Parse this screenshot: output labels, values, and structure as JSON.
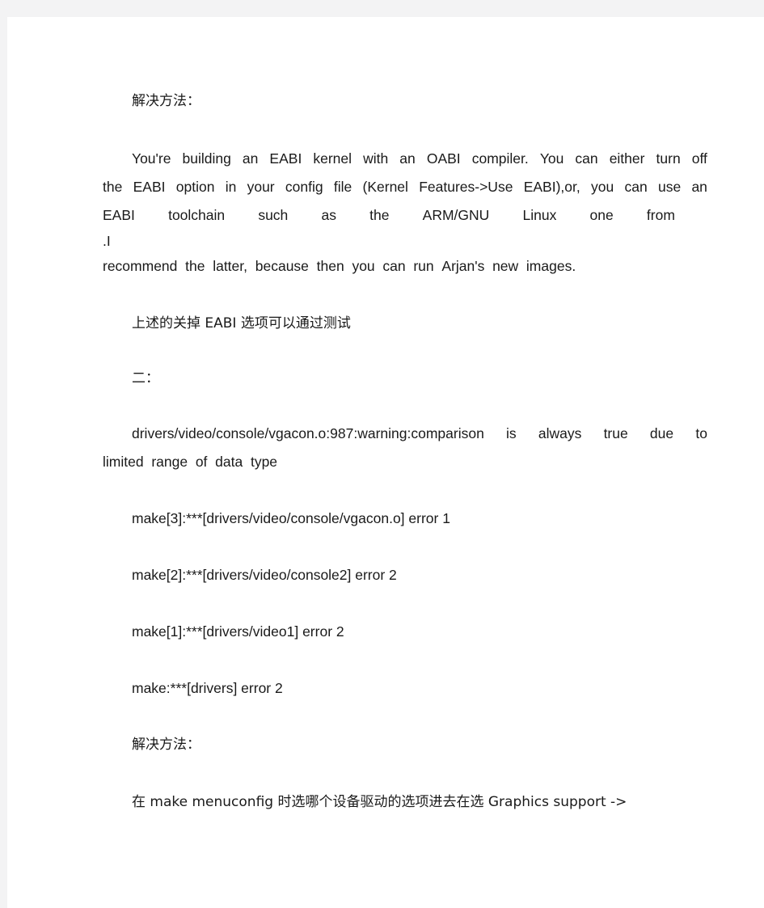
{
  "page": {
    "background_color": "#ffffff",
    "frame_color": "#f3f3f4",
    "text_color": "#1a1a1a"
  },
  "content": {
    "heading_solution_1": "解决方法：",
    "english_paragraph": {
      "line1_words": [
        "You're",
        "building",
        "an",
        "EABI",
        "kernel",
        "with",
        "an",
        "OABI",
        "compiler.",
        "You",
        "can",
        "either",
        "turn",
        "off"
      ],
      "line2_words": [
        "the",
        "EABI",
        "option",
        "in",
        "your",
        "config",
        "file",
        "(Kernel",
        "Features->Use",
        "EABI),or,",
        "you",
        "can",
        "use",
        "an"
      ],
      "line3_words": [
        "EABI",
        "toolchain",
        "such",
        "as",
        "the",
        "ARM/GNU",
        "Linux",
        "one",
        "from"
      ],
      "line4": ".I",
      "line5_words": [
        "recommend",
        "the",
        "latter,",
        "because",
        "then",
        "you",
        "can",
        "run",
        "Arjan's",
        "new",
        "images."
      ]
    },
    "note_eabi": "上述的关掉 EABI 选项可以通过测试",
    "heading_section_two": "二：",
    "warning": {
      "line1_words": [
        "drivers/video/console/vgacon.o:987:warning:comparison",
        "is",
        "always",
        "true",
        "due",
        "to"
      ],
      "line2_words": [
        "limited",
        "range",
        "of",
        "data",
        "type"
      ]
    },
    "make_errors": [
      "make[3]:***[drivers/video/console/vgacon.o] error 1",
      "make[2]:***[drivers/video/console2] error 2",
      "make[1]:***[drivers/video1] error 2",
      "make:***[drivers] error 2"
    ],
    "heading_solution_2": "解决方法：",
    "menuconfig_hint": "在 make menuconfig 时选哪个设备驱动的选项进去在选 Graphics support ->"
  }
}
